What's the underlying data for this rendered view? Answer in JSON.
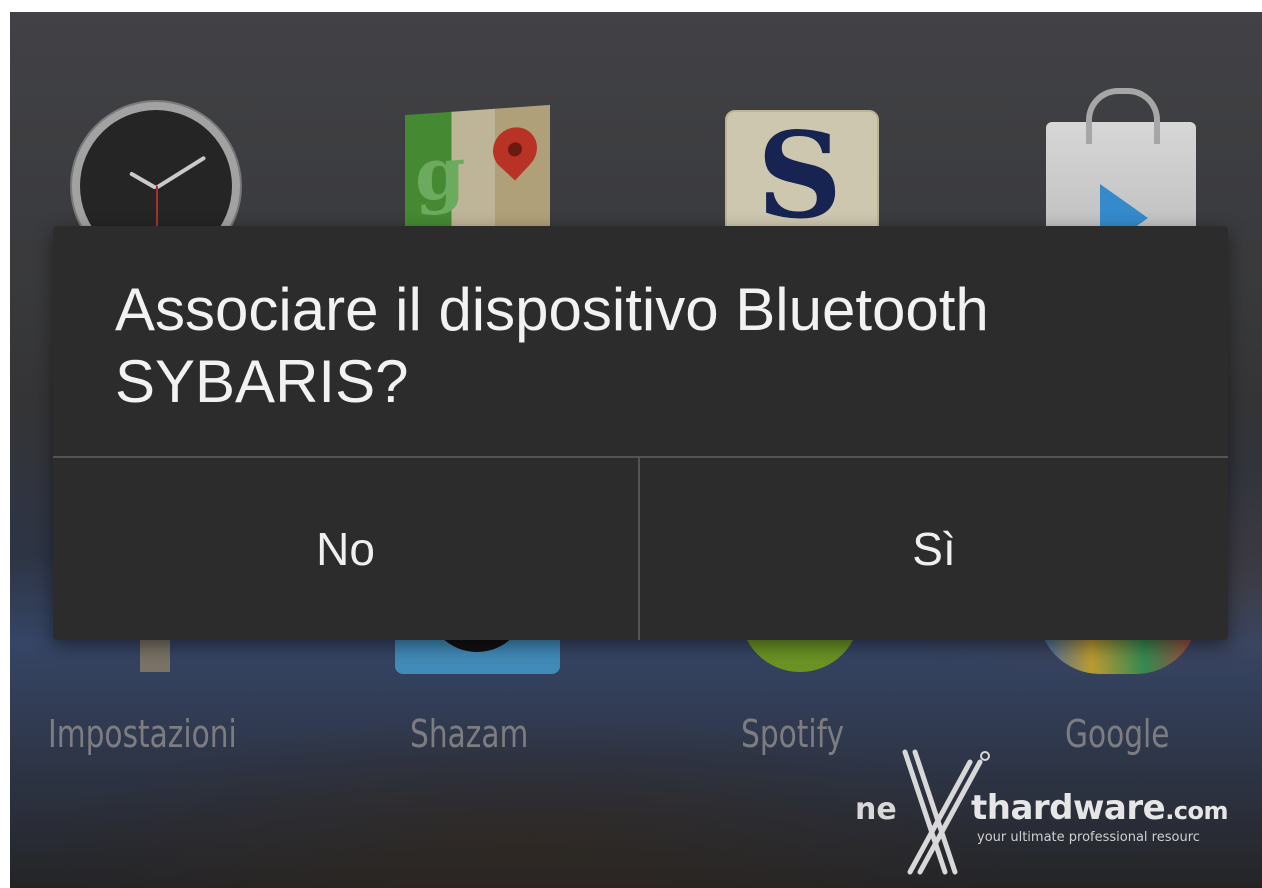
{
  "dialog": {
    "message": "Associare il dispositivo Bluetooth SYBARIS?",
    "negative_label": "No",
    "positive_label": "Sì"
  },
  "home_apps": [
    {
      "label": "Impostazioni",
      "icon": "settings-icon"
    },
    {
      "label": "Shazam",
      "icon": "shazam-icon"
    },
    {
      "label": "Spotify",
      "icon": "spotify-icon"
    },
    {
      "label": "Google",
      "icon": "google-icon"
    }
  ],
  "top_apps": [
    {
      "icon": "clock-icon"
    },
    {
      "icon": "maps-icon"
    },
    {
      "icon": "s-app-icon",
      "glyph": "S"
    },
    {
      "icon": "play-store-icon"
    }
  ],
  "watermark": {
    "prefix": "ne",
    "brand": "thardware",
    "domain": ".com",
    "tagline": "your ultimate professional resourc"
  },
  "colors": {
    "dialog_bg": "#2c2c2c",
    "dialog_text": "#f2f2f2",
    "divider": "#545454",
    "app_label": "#8f8f93"
  }
}
